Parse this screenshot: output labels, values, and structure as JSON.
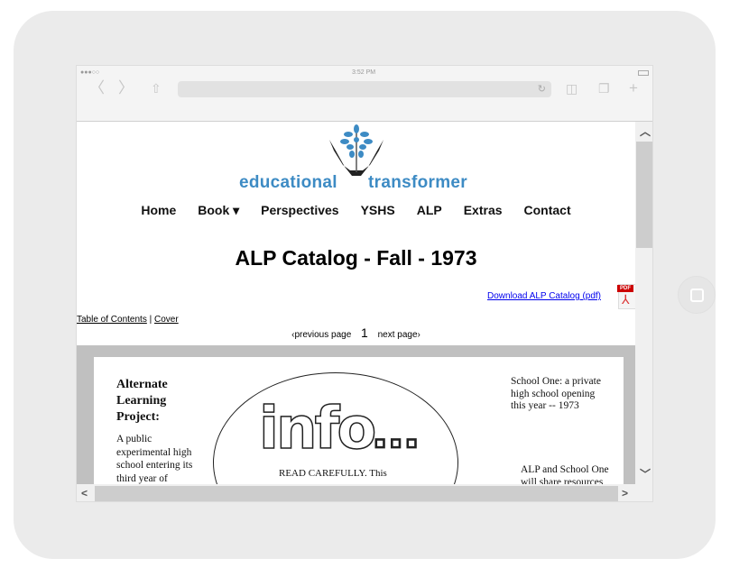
{
  "device": {
    "status_time": "3:52 PM",
    "signal": "●●●○○"
  },
  "browser": {
    "back_icon": "chevron-left",
    "forward_icon": "chevron-right",
    "share_icon": "share",
    "reload_icon": "reload",
    "bookmarks_icon": "book",
    "tabs_icon": "tabs",
    "new_tab_icon": "plus",
    "url": ""
  },
  "site": {
    "logo_left": "educational",
    "logo_right": "transformer",
    "nav": [
      {
        "label": "Home"
      },
      {
        "label": "Book ▾"
      },
      {
        "label": "Perspectives"
      },
      {
        "label": "YSHS"
      },
      {
        "label": "ALP"
      },
      {
        "label": "Extras"
      },
      {
        "label": "Contact"
      }
    ],
    "title": "ALP Catalog - Fall - 1973",
    "download_link": "Download ALP Catalog (pdf)",
    "pdf_badge": "PDF",
    "toc_link": "Table of Contents",
    "toc_sep": " | ",
    "cover_link": "Cover",
    "prev": "‹previous page",
    "page_num": "1",
    "next": "next page›"
  },
  "scan": {
    "heading": "Alternate Learning Project:",
    "col1": "A public experimental high school entering its third year of",
    "info": "info",
    "info_dots": "▫▫▫",
    "read": "READ CAREFULLY.  This",
    "col3": "School One:  a private high school opening this year -- 1973",
    "col4": "ALP and School One will share resources"
  },
  "colors": {
    "logo_blue": "#3d8bc4",
    "link": "#0000ee",
    "scan_bg": "#c0c0c0"
  }
}
